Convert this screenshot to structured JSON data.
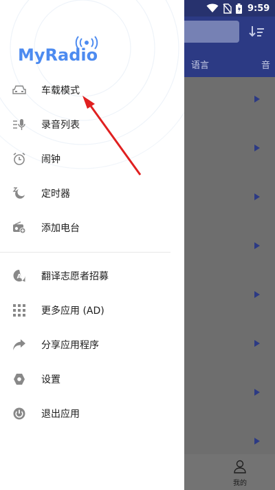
{
  "status_bar": {
    "time": "9:59",
    "icons": [
      "wifi-icon",
      "no-sim-icon",
      "battery-icon"
    ]
  },
  "background": {
    "tabs": [
      "语言",
      "音"
    ],
    "bottom_nav": {
      "me_label": "我的",
      "me_icon": "person-icon"
    },
    "play_buttons": 8
  },
  "drawer": {
    "logo": "MyRadio",
    "items": [
      {
        "label": "车载模式",
        "icon": "car-icon"
      },
      {
        "label": "录音列表",
        "icon": "mic-list-icon"
      },
      {
        "label": "闹钟",
        "icon": "alarm-icon"
      },
      {
        "label": "定时器",
        "icon": "sleep-timer-icon"
      },
      {
        "label": "添加电台",
        "icon": "add-radio-icon"
      },
      {
        "label": "翻译志愿者招募",
        "icon": "translate-icon"
      },
      {
        "label": "更多应用 (AD)",
        "icon": "apps-grid-icon"
      },
      {
        "label": "分享应用程序",
        "icon": "share-icon"
      },
      {
        "label": "设置",
        "icon": "settings-icon"
      },
      {
        "label": "退出应用",
        "icon": "power-icon"
      }
    ]
  },
  "colors": {
    "header": "#2c3a84",
    "logo": "#4d8bf0",
    "annotation_arrow": "#e02020"
  }
}
